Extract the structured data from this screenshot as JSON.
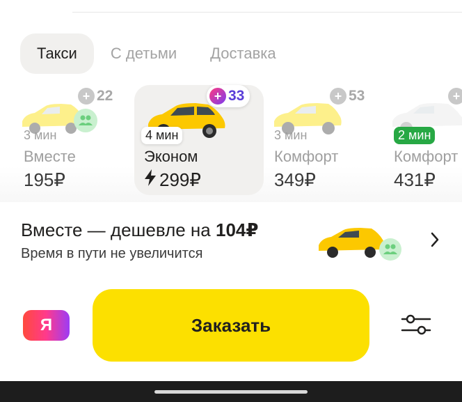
{
  "tabs": [
    {
      "label": "Такси",
      "active": true
    },
    {
      "label": "С детьми",
      "active": false
    },
    {
      "label": "Доставка",
      "active": false
    }
  ],
  "tariffs": [
    {
      "time": "3 мин",
      "name": "Вместе",
      "price": "195₽",
      "plus": "22"
    },
    {
      "time": "4 мин",
      "name": "Эконом",
      "price": "299₽",
      "plus": "33",
      "selected": true
    },
    {
      "time": "3 мин",
      "name": "Комфорт",
      "price": "349₽",
      "plus": "53"
    },
    {
      "time": "2 мин",
      "name": "Комфорт",
      "price": "431₽"
    }
  ],
  "banner": {
    "title_prefix": "Вместе — дешевле на ",
    "title_amount": "104₽",
    "subtitle": "Время в пути не увеличится"
  },
  "logo_letter": "Я",
  "order_label": "Заказать",
  "colors": {
    "accent": "#fce000",
    "fast": "#27a844",
    "selected_bg": "#f1f0ee"
  }
}
